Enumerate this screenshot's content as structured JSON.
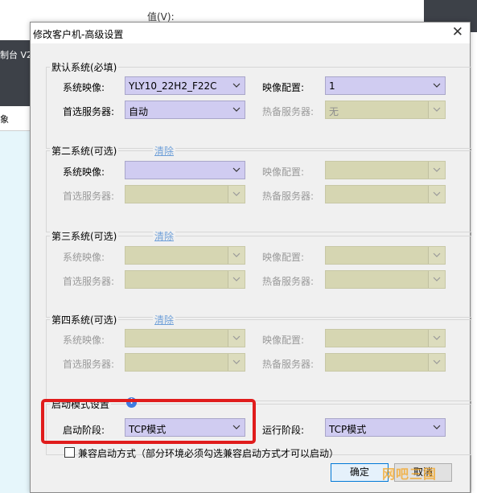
{
  "background": {
    "top_label": "值(V):",
    "left_dark_text": "制台 V2",
    "left_panel_text": "象"
  },
  "dialog": {
    "title": "修改客户机-高级设置",
    "close_icon": "close-icon",
    "labels": {
      "system_image": "系统映像:",
      "image_config": "映像配置:",
      "preferred_server": "首选服务器:",
      "standby_server": "热备服务器:"
    },
    "clear_label": "清除",
    "default_system": {
      "title": "默认系统(必填)",
      "system_image": "YLY10_22H2_F22C",
      "image_config": "1",
      "preferred_server": "自动",
      "standby_server": "无"
    },
    "second_system": {
      "title": "第二系统(可选)"
    },
    "third_system": {
      "title": "第三系统(可选)"
    },
    "fourth_system": {
      "title": "第四系统(可选)"
    },
    "boot_mode": {
      "title": "启动模式设置",
      "info_icon": "i",
      "boot_stage_label": "启动阶段:",
      "boot_stage_value": "TCP模式",
      "run_stage_label": "运行阶段:",
      "run_stage_value": "TCP模式"
    },
    "compat_checkbox_label": "兼容启动方式（部分环境必须勾选兼容启动方式才可以启动）",
    "ok_button": "确定",
    "cancel_button": "取消",
    "watermark": "网吧三国"
  },
  "colors": {
    "combo_active": "#d0ccf1",
    "combo_disabled": "#d6d6b2",
    "highlight": "#e01c1c",
    "link": "#6e9fd8"
  }
}
